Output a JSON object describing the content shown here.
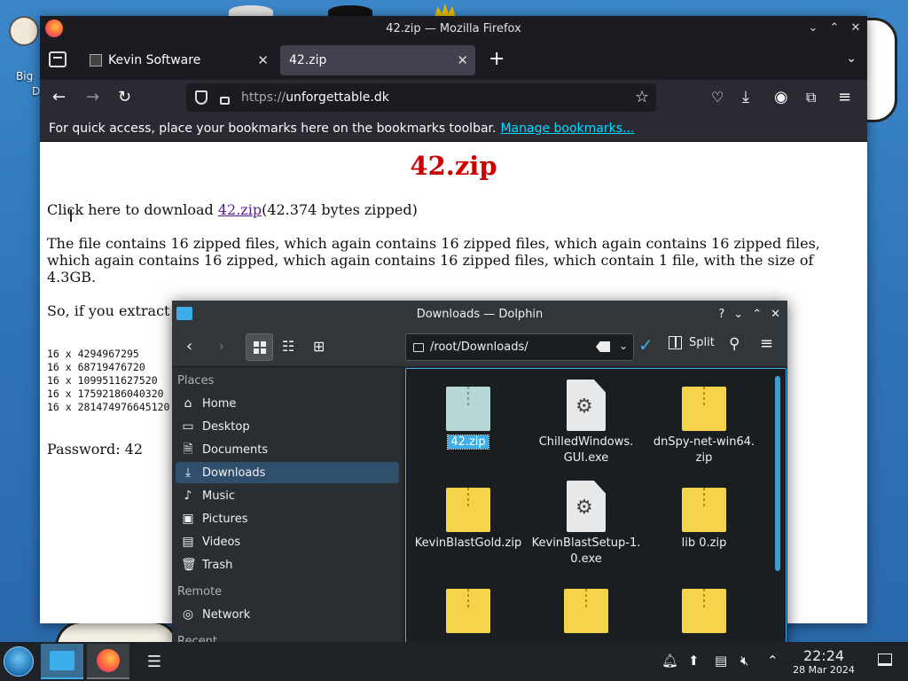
{
  "desktop": {
    "label_line1": "Big",
    "label_line2": "D"
  },
  "firefox": {
    "window_title": "42.zip — Mozilla Firefox",
    "tabs": [
      {
        "label": "Kevin Software"
      },
      {
        "label": "42.zip"
      }
    ],
    "url_prefix": "https://",
    "url_host": "unforgettable.dk",
    "bookmarks_hint": "For quick access, place your bookmarks here on the bookmarks toolbar.",
    "manage_bookmarks": "Manage bookmarks...",
    "page": {
      "heading": "42.zip",
      "download_prefix": "Click here to download",
      "download_link": "42.zip",
      "download_suffix": "(42.374 bytes zipped)",
      "description": "The file contains 16 zipped files, which again contains 16 zipped files, which again contains 16 zipped files, which again contains 16 zipped, which again contains 16 zipped files, which contain 1 file, with the size of 4.3GB.",
      "extract_text": "So, if you extract",
      "math": [
        "16 x 4294967295",
        "16 x 68719476720",
        "16 x 1099511627520",
        "16 x 17592186040320",
        "16 x 281474976645120"
      ],
      "password": "Password: 42"
    }
  },
  "dolphin": {
    "window_title": "Downloads — Dolphin",
    "location": "/root/Downloads/",
    "split_label": "Split",
    "places_header": "Places",
    "places": [
      {
        "label": "Home",
        "icon": "home-icon"
      },
      {
        "label": "Desktop",
        "icon": "desktop-icon"
      },
      {
        "label": "Documents",
        "icon": "documents-icon"
      },
      {
        "label": "Downloads",
        "icon": "downloads-icon"
      },
      {
        "label": "Music",
        "icon": "music-icon"
      },
      {
        "label": "Pictures",
        "icon": "pictures-icon"
      },
      {
        "label": "Videos",
        "icon": "videos-icon"
      },
      {
        "label": "Trash",
        "icon": "trash-icon"
      }
    ],
    "remote_header": "Remote",
    "remote": [
      {
        "label": "Network",
        "icon": "network-icon"
      }
    ],
    "recent_header": "Recent",
    "files": [
      {
        "name": "42.zip",
        "type": "zip",
        "selected": true
      },
      {
        "name": "ChilledWindows.\nGUI.exe",
        "type": "exe"
      },
      {
        "name": "dnSpy-net-win64.\nzip",
        "type": "zip"
      },
      {
        "name": "KevinBlastGold.zip",
        "type": "zip"
      },
      {
        "name": "KevinBlastSetup-1.\n0.exe",
        "type": "exe"
      },
      {
        "name": "lib 0.zip",
        "type": "zip"
      },
      {
        "name": "",
        "type": "zip"
      },
      {
        "name": "",
        "type": "zip"
      },
      {
        "name": "",
        "type": "zip"
      }
    ],
    "accent": "#3daee9"
  },
  "taskbar": {
    "time": "22:24",
    "date": "28 Mar 2024"
  }
}
